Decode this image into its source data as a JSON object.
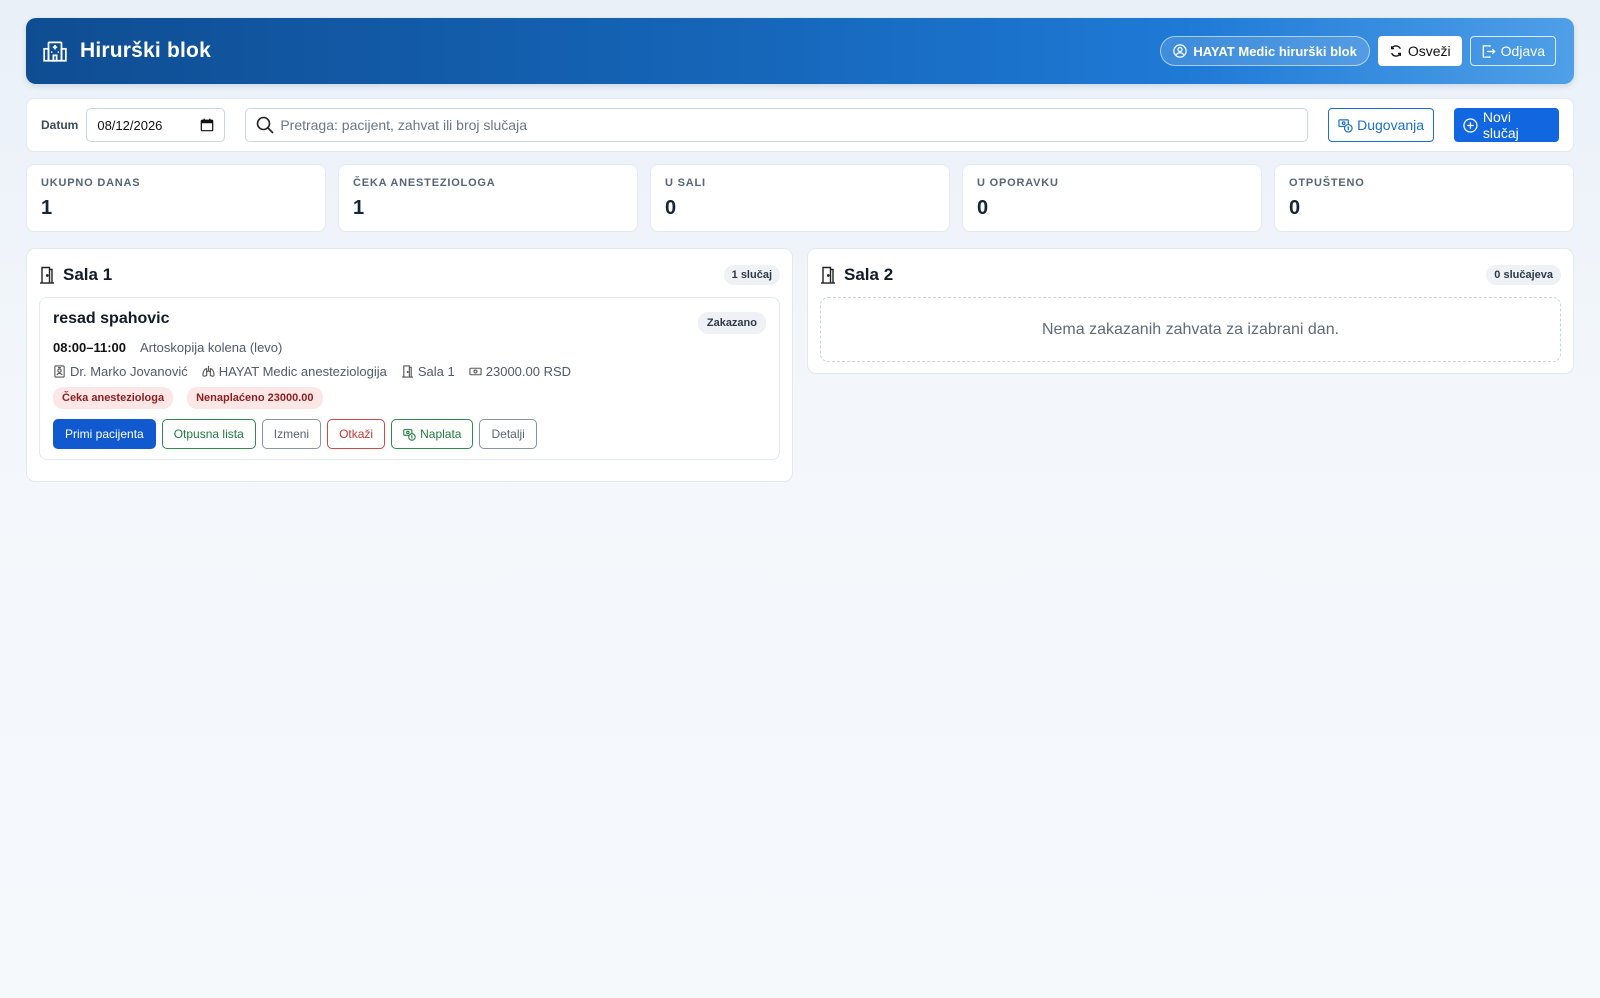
{
  "header": {
    "title": "Hirurški blok",
    "user_label": "HAYAT Medic hirurški blok",
    "refresh_label": "Osveži",
    "logout_label": "Odjava"
  },
  "toolbar": {
    "date_label": "Datum",
    "date_value": "08/12/2026",
    "search_placeholder": "Pretraga: pacijent, zahvat ili broj slučaja",
    "debts_label": "Dugovanja",
    "new_case_label": "Novi slučaj"
  },
  "stats": [
    {
      "label": "UKUPNO DANAS",
      "value": "1"
    },
    {
      "label": "ČEKA ANESTEZIOLOGA",
      "value": "1"
    },
    {
      "label": "U SALI",
      "value": "0"
    },
    {
      "label": "U OPORAVKU",
      "value": "0"
    },
    {
      "label": "OTPUŠTENO",
      "value": "0"
    }
  ],
  "rooms": [
    {
      "name": "Sala 1",
      "count": "1 slučaj",
      "case": {
        "patient": "resad spahovic",
        "status": "Zakazano",
        "time": "08:00–11:00",
        "procedure": "Artoskopija kolena (levo)",
        "surgeon": "Dr. Marko Jovanović",
        "anesthesia": "HAYAT Medic anesteziologija",
        "room": "Sala 1",
        "price": "23000.00 RSD",
        "tags": [
          "Čeka anesteziologa",
          "Nenaplaćeno 23000.00"
        ],
        "actions": {
          "admit": "Primi pacijenta",
          "discharge": "Otpusna lista",
          "edit": "Izmeni",
          "cancel": "Otkaži",
          "billing": "Naplata",
          "details": "Detalji"
        }
      }
    },
    {
      "name": "Sala 2",
      "count": "0 slučajeva",
      "empty_text": "Nema zakazanih zahvata za izabrani dan."
    }
  ]
}
